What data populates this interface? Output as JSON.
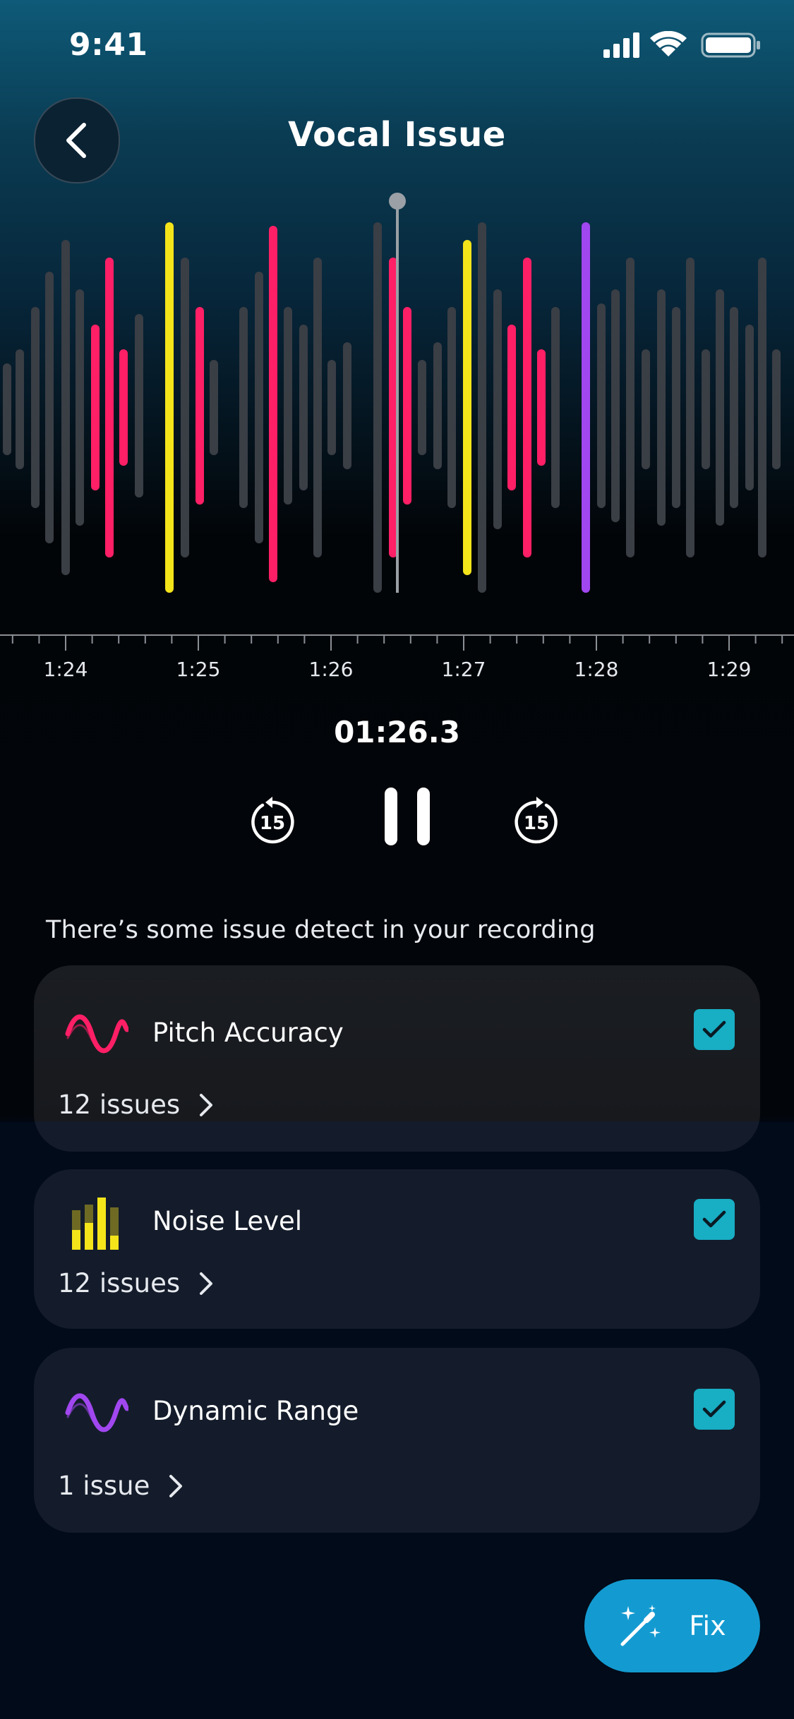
{
  "status_bar": {
    "time": "9:41"
  },
  "header": {
    "title": "Vocal Issue"
  },
  "timeline": {
    "labels": [
      "1:24",
      "1:25",
      "1:26",
      "1:27",
      "1:28",
      "1:29"
    ]
  },
  "player": {
    "current_time": "01:26.3",
    "skip_seconds": "15"
  },
  "message": "There’s some issue detect in your recording",
  "issues": [
    {
      "title": "Pitch Accuracy",
      "count_label": "12 issues",
      "color": "#ff1f66",
      "checked": true
    },
    {
      "title": "Noise Level",
      "count_label": "12 issues",
      "color": "#f4e41a",
      "checked": true
    },
    {
      "title": "Dynamic Range",
      "count_label": "1 issue",
      "color": "#a147f0",
      "checked": true
    }
  ],
  "fix_button": {
    "label": "Fix"
  },
  "colors": {
    "pitch": "#ff1f66",
    "noise": "#f4e41a",
    "dynamic": "#a147f0",
    "neutral_bar": "#3a3e45",
    "accent": "#139bd1",
    "check": "#18aec4"
  }
}
